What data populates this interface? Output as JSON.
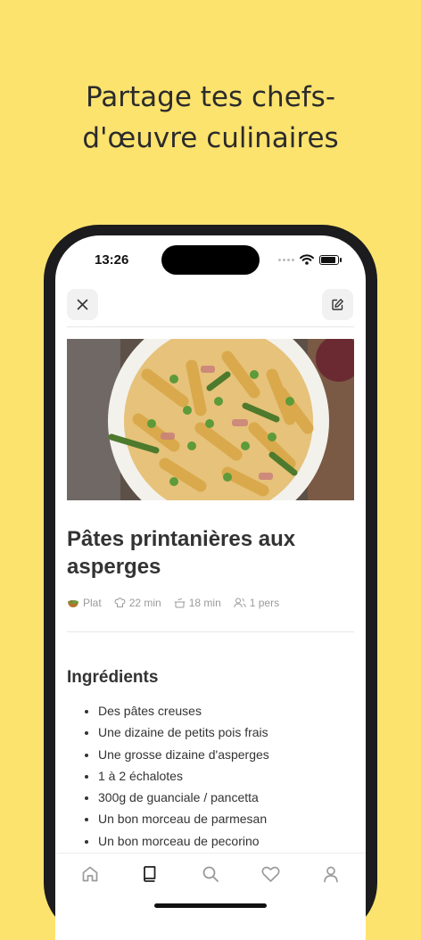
{
  "headline": {
    "line1": "Partage tes chefs-",
    "line2": "d'œuvre culinaires"
  },
  "status_bar": {
    "time": "13:26",
    "icons": [
      "cellular-dots-icon",
      "wifi-icon",
      "battery-icon"
    ]
  },
  "toolbar": {
    "close_icon": "close-icon",
    "edit_icon": "edit-icon"
  },
  "recipe": {
    "image_icon": "pasta-bowl-photo",
    "title": "Pâtes printanières aux asperges",
    "meta": {
      "category": "Plat",
      "prep_time": "22 min",
      "cook_time": "18 min",
      "servings": "1 pers"
    },
    "ingredients_title": "Ingrédients",
    "ingredients": [
      "Des pâtes creuses",
      "Une dizaine de petits pois frais",
      "Une grosse dizaine d'asperges",
      "1 à 2 échalotes",
      "300g de guanciale / pancetta",
      "Un bon morceau de parmesan",
      "Un bon morceau de pecorino"
    ]
  },
  "tabbar": {
    "tabs": [
      {
        "icon": "home-icon",
        "active": false
      },
      {
        "icon": "book-icon",
        "active": true
      },
      {
        "icon": "search-icon",
        "active": false
      },
      {
        "icon": "heart-icon",
        "active": false
      },
      {
        "icon": "profile-icon",
        "active": false
      }
    ]
  },
  "colors": {
    "background": "#FCE36E",
    "text": "#333333",
    "muted": "#9A9A9A",
    "tab_active": "#222222",
    "tab_inactive": "#9A9A9A"
  }
}
